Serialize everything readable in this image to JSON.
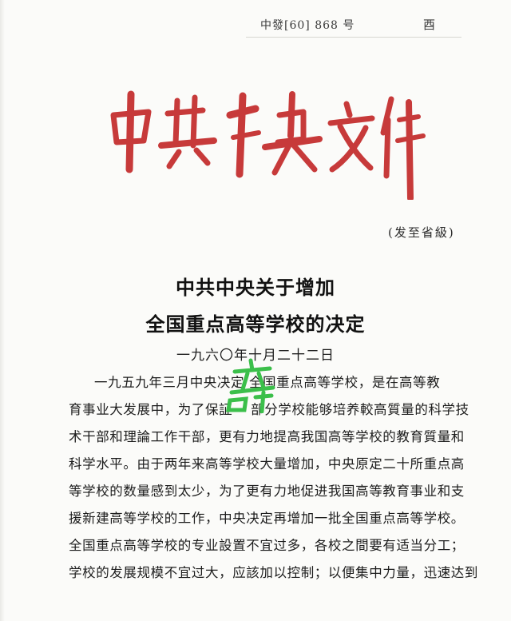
{
  "header": {
    "doc_number": "中發[60] 868 号",
    "mark": "酉"
  },
  "masthead": {
    "text": "中共中央文件",
    "color": "#c73a3a"
  },
  "distribution": "(发至省級)",
  "title": {
    "line1": "中共中央关于增加",
    "line2": "全国重点高等学校的决定"
  },
  "date": "一九六〇年十月二十二日",
  "body_lines": [
    "一九五九年三月中央决定 全国重点高等学校，是在高等教",
    "育事业大发展中，为了保証一 部分学校能够培养較高質量的科学技",
    "术干部和理論工作干部，更有力地提高我国高等学校的教育質量和",
    "科学水平。由于两年来高等学校大量增加，中央原定二十所重点高",
    "等学校的数量感到太少，为了更有力地促进我国高等教育事业和支",
    "援新建高等学校的工作，中央决定再增加一批全国重点高等学校。",
    "全国重点高等学校的专业設置不宜过多，各校之間要有适当分工；",
    "学校的发展规模不宜过大，应該加以控制；以便集中力量，迅速达到"
  ],
  "watermark": {
    "color": "#3bbf4a"
  }
}
